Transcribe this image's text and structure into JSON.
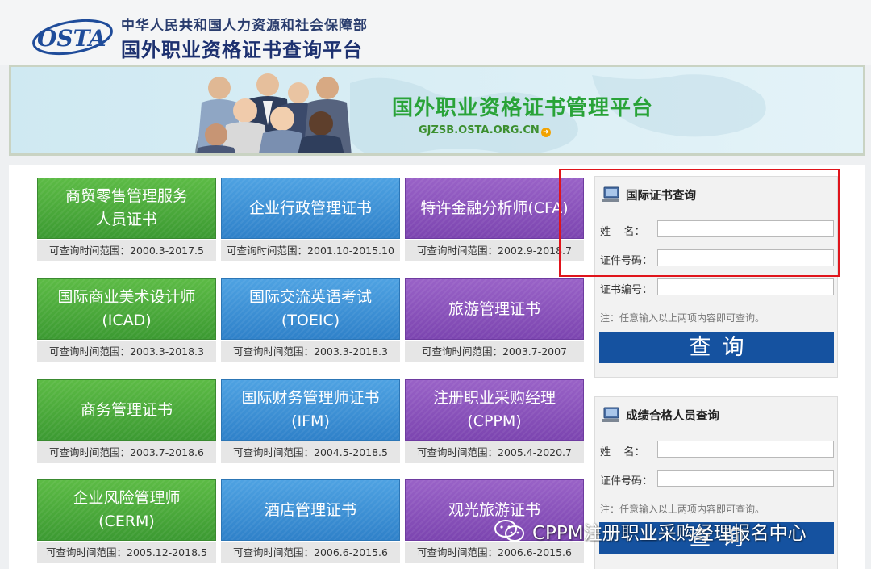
{
  "header": {
    "logo_text": "OSTA",
    "org_name": "中华人民共和国人力资源和社会保障部",
    "platform_name": "国外职业资格证书查询平台"
  },
  "banner": {
    "title": "国外职业资格证书管理平台",
    "url": "GJZSB.OSTA.ORG.CN"
  },
  "tiles": [
    {
      "lines": [
        "商贸零售管理服务",
        "人员证书"
      ],
      "range": "可查询时间范围：2000.3-2017.5",
      "color": "green"
    },
    {
      "lines": [
        "企业行政管理证书"
      ],
      "range": "可查询时间范围：2001.10-2015.10",
      "color": "blue"
    },
    {
      "lines": [
        "特许金融分析师(CFA)"
      ],
      "range": "可查询时间范围：2002.9-2018.7",
      "color": "purple"
    },
    {
      "lines": [
        "国际商业美术设计师",
        "(ICAD)"
      ],
      "range": "可查询时间范围：2003.3-2018.3",
      "color": "green"
    },
    {
      "lines": [
        "国际交流英语考试",
        "(TOEIC)"
      ],
      "range": "可查询时间范围：2003.3-2018.3",
      "color": "blue"
    },
    {
      "lines": [
        "旅游管理证书"
      ],
      "range": "可查询时间范围：2003.7-2007",
      "color": "purple"
    },
    {
      "lines": [
        "商务管理证书"
      ],
      "range": "可查询时间范围：2003.7-2018.6",
      "color": "green"
    },
    {
      "lines": [
        "国际财务管理师证书",
        "(IFM)"
      ],
      "range": "可查询时间范围：2004.5-2018.5",
      "color": "blue"
    },
    {
      "lines": [
        "注册职业采购经理",
        "(CPPM)"
      ],
      "range": "可查询时间范围：2005.4-2020.7",
      "color": "purple"
    },
    {
      "lines": [
        "企业风险管理师",
        "(CERM)"
      ],
      "range": "可查询时间范围：2005.12-2018.5",
      "color": "green"
    },
    {
      "lines": [
        "酒店管理证书"
      ],
      "range": "可查询时间范围：2006.6-2015.6",
      "color": "blue"
    },
    {
      "lines": [
        "观光旅游证书"
      ],
      "range": "可查询时间范围：2006.6-2015.6",
      "color": "purple"
    }
  ],
  "cert_query": {
    "title": "国际证书查询",
    "name_label": "姓    名：",
    "name_value": "",
    "id_label": "证件号码：",
    "id_value": "",
    "cert_no_label": "证书编号：",
    "cert_no_value": "",
    "note": "注：任意输入以上两项内容即可查询。",
    "button": "查询"
  },
  "pass_query": {
    "title": "成绩合格人员查询",
    "name_label": "姓    名：",
    "name_value": "",
    "id_label": "证件号码：",
    "id_value": "",
    "note": "注：任意输入以上两项内容即可查询。",
    "button": "查询"
  },
  "watermark": {
    "text": "CPPM注册职业采购经理报名中心"
  },
  "colors": {
    "green_tile": "#45a63c",
    "blue_tile": "#3a8fd6",
    "purple_tile": "#8a52bc",
    "query_button": "#1552a0",
    "highlight": "#e0141b",
    "banner_title": "#29a338"
  }
}
